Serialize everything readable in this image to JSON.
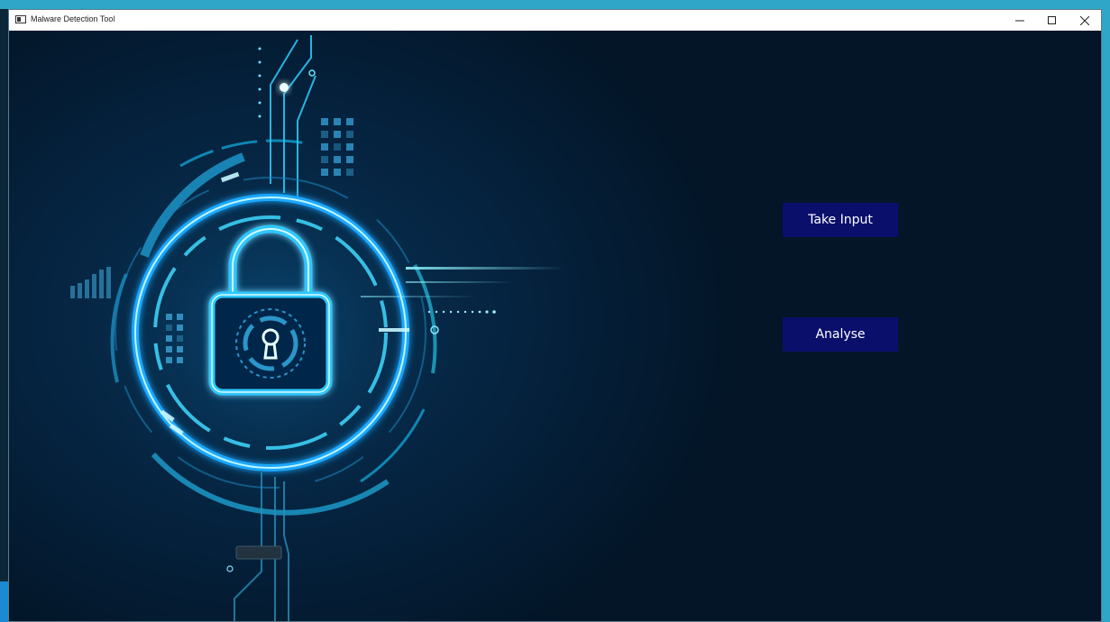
{
  "window": {
    "title": "Malware Detection Tool",
    "controls": [
      "minimize-icon",
      "maximize-icon",
      "close-icon"
    ]
  },
  "hero": {
    "icon": "padlock-icon",
    "colors": {
      "glow": "#18c8ff",
      "ring": "#1e9bff",
      "background": "#04182c"
    }
  },
  "actions": {
    "take_input_label": "Take Input",
    "analyse_label": "Analyse",
    "button_color": "#0a0f6b"
  }
}
